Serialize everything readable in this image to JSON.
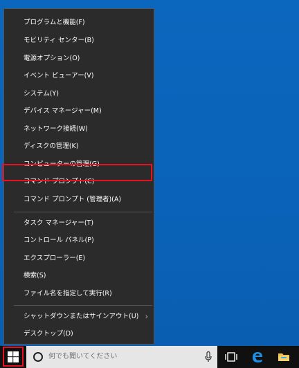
{
  "menu": {
    "items": [
      {
        "label": "プログラムと機能(F)"
      },
      {
        "label": "モビリティ センター(B)"
      },
      {
        "label": "電源オプション(O)"
      },
      {
        "label": "イベント ビューアー(V)"
      },
      {
        "label": "システム(Y)"
      },
      {
        "label": "デバイス マネージャー(M)"
      },
      {
        "label": "ネットワーク接続(W)"
      },
      {
        "label": "ディスクの管理(K)"
      },
      {
        "label": "コンピューターの管理(G)"
      },
      {
        "label": "コマンド プロンプト(C)"
      },
      {
        "label": "コマンド プロンプト (管理者)(A)"
      },
      {
        "label": "タスク マネージャー(T)"
      },
      {
        "label": "コントロール パネル(P)"
      },
      {
        "label": "エクスプローラー(E)"
      },
      {
        "label": "検索(S)"
      },
      {
        "label": "ファイル名を指定して実行(R)"
      },
      {
        "label": "シャットダウンまたはサインアウト(U)"
      },
      {
        "label": "デスクトップ(D)"
      }
    ],
    "submenu_chevron": "›"
  },
  "taskbar": {
    "search_placeholder": "何でも聞いてください",
    "icons": [
      "windows-start-icon",
      "search-circle-icon",
      "microphone-icon",
      "task-view-icon",
      "edge-icon",
      "file-explorer-icon"
    ]
  },
  "colors": {
    "highlight": "#e81123",
    "desktop": "#0a63b8",
    "menu_bg": "#2b2b2b"
  }
}
